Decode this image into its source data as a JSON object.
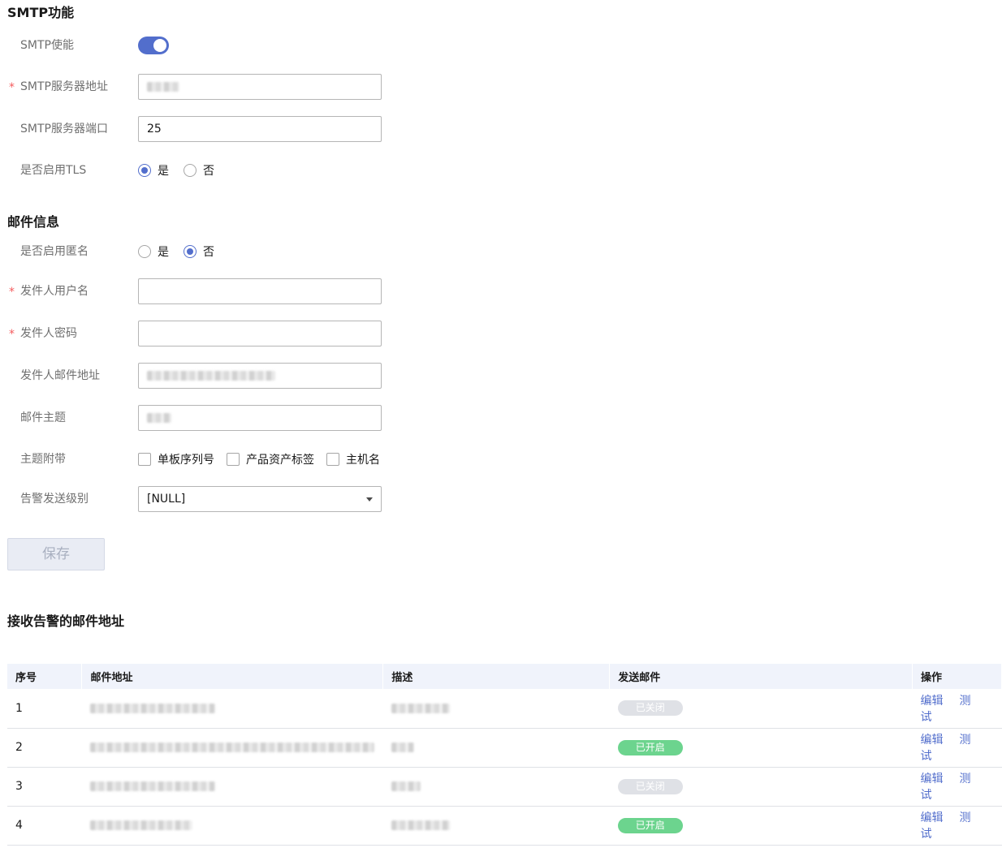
{
  "smtp_section": {
    "title": "SMTP功能",
    "enable_label": "SMTP使能",
    "enable_on": true,
    "server_addr_label": "SMTP服务器地址",
    "server_port_label": "SMTP服务器端口",
    "server_port_value": "25",
    "tls_label": "是否启用TLS",
    "tls_yes": "是",
    "tls_no": "否",
    "tls_selected": "是"
  },
  "mail_section": {
    "title": "邮件信息",
    "anon_label": "是否启用匿名",
    "anon_yes": "是",
    "anon_no": "否",
    "anon_selected": "否",
    "sender_user_label": "发件人用户名",
    "sender_user_value": "",
    "sender_pwd_label": "发件人密码",
    "sender_pwd_value": "",
    "sender_addr_label": "发件人邮件地址",
    "subject_label": "邮件主题",
    "subject_attach_label": "主题附带",
    "attach_options": [
      "单板序列号",
      "产品资产标签",
      "主机名"
    ],
    "alarm_level_label": "告警发送级别",
    "alarm_level_value": "[NULL]"
  },
  "save_label": "保存",
  "recipients": {
    "title": "接收告警的邮件地址",
    "columns": [
      "序号",
      "邮件地址",
      "描述",
      "发送邮件",
      "操作"
    ],
    "rows": [
      {
        "index": "1",
        "status": "已关闭",
        "enabled": false
      },
      {
        "index": "2",
        "status": "已开启",
        "enabled": true
      },
      {
        "index": "3",
        "status": "已关闭",
        "enabled": false
      },
      {
        "index": "4",
        "status": "已开启",
        "enabled": true
      }
    ],
    "edit_label": "编辑",
    "test_label": "测试"
  },
  "colors": {
    "accent": "#526ecc",
    "required": "#f45c5e",
    "enabled_badge": "#6cd48e",
    "disabled_badge": "#dfe1e6"
  }
}
